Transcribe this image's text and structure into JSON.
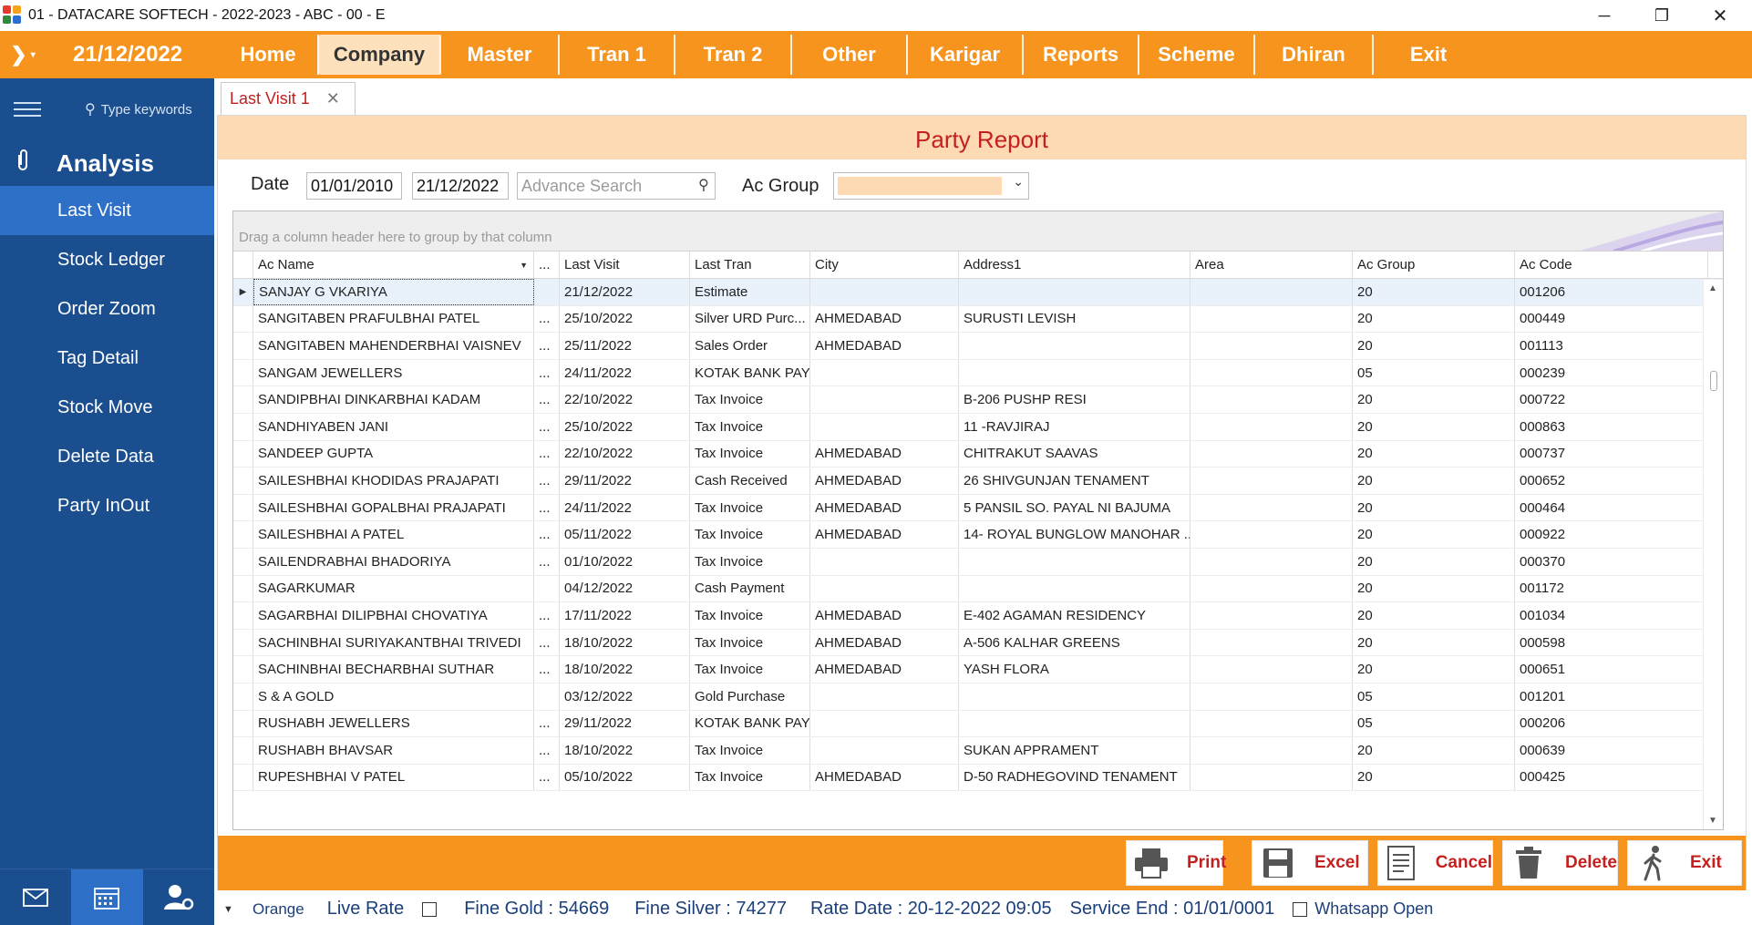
{
  "window": {
    "title": "01 - DATACARE SOFTECH - 2022-2023 - ABC - 00 - E",
    "minimize": "─",
    "maximize": "❐",
    "close": "✕"
  },
  "menubar": {
    "date": "21/12/2022",
    "items": [
      "Home",
      "Company",
      "Master",
      "Tran 1",
      "Tran 2",
      "Other",
      "Karigar",
      "Reports",
      "Scheme",
      "Dhiran",
      "Exit"
    ],
    "active": "Company"
  },
  "sidebar": {
    "search_placeholder": "Type keywords",
    "section": "Analysis",
    "items": [
      "Last Visit",
      "Stock Ledger",
      "Order Zoom",
      "Tag Detail",
      "Stock Move",
      "Delete Data",
      "Party InOut"
    ],
    "active": "Last Visit"
  },
  "tab": {
    "label": "Last Visit 1",
    "close": "✕"
  },
  "report": {
    "title": "Party Report",
    "date_label": "Date",
    "from_date": "01/01/2010",
    "to_date": "21/12/2022",
    "search_placeholder": "Advance Search",
    "acgroup_label": "Ac Group",
    "acgroup_value": ""
  },
  "grid": {
    "group_hint": "Drag a column header here to group by that column",
    "columns": [
      "Ac Name",
      "...",
      "Last Visit",
      "Last Tran",
      "City",
      "Address1",
      "Area",
      "Ac Group",
      "Ac Code"
    ],
    "rows": [
      [
        "SANJAY G VKARIYA",
        "",
        "21/12/2022",
        "Estimate",
        "",
        "",
        "",
        "20",
        "001206"
      ],
      [
        "SANGITABEN PRAFULBHAI PATEL",
        "...",
        "25/10/2022",
        "Silver URD Purc...",
        "AHMEDABAD",
        "SURUSTI LEVISH",
        "",
        "20",
        "000449"
      ],
      [
        "SANGITABEN MAHENDERBHAI VAISNEV",
        "...",
        "25/11/2022",
        "Sales Order",
        "AHMEDABAD",
        "",
        "",
        "20",
        "001113"
      ],
      [
        "SANGAM JEWELLERS",
        "...",
        "24/11/2022",
        "KOTAK BANK PAY",
        "",
        "",
        "",
        "05",
        "000239"
      ],
      [
        "SANDIPBHAI DINKARBHAI KADAM",
        "...",
        "22/10/2022",
        "Tax Invoice",
        "",
        "B-206 PUSHP RESI",
        "",
        "20",
        "000722"
      ],
      [
        "SANDHIYABEN JANI",
        "...",
        "25/10/2022",
        "Tax Invoice",
        "",
        "11 -RAVJIRAJ",
        "",
        "20",
        "000863"
      ],
      [
        "SANDEEP GUPTA",
        "...",
        "22/10/2022",
        "Tax Invoice",
        "AHMEDABAD",
        "CHITRAKUT SAAVAS",
        "",
        "20",
        "000737"
      ],
      [
        "SAILESHBHAI KHODIDAS PRAJAPATI",
        "...",
        "29/11/2022",
        "Cash Received",
        "AHMEDABAD",
        "26 SHIVGUNJAN TENAMENT",
        "",
        "20",
        "000652"
      ],
      [
        "SAILESHBHAI GOPALBHAI PRAJAPATI",
        "...",
        "24/11/2022",
        "Tax Invoice",
        "AHMEDABAD",
        "5 PANSIL SO. PAYAL NI BAJUMA",
        "",
        "20",
        "000464"
      ],
      [
        "SAILESHBHAI A PATEL",
        "...",
        "05/11/2022",
        "Tax Invoice",
        "AHMEDABAD",
        "14- ROYAL BUNGLOW MANOHAR ...",
        "",
        "20",
        "000922"
      ],
      [
        "SAILENDRABHAI BHADORIYA",
        "...",
        "01/10/2022",
        "Tax Invoice",
        "",
        "",
        "",
        "20",
        "000370"
      ],
      [
        "SAGARKUMAR",
        "",
        "04/12/2022",
        "Cash Payment",
        "",
        "",
        "",
        "20",
        "001172"
      ],
      [
        "SAGARBHAI DILIPBHAI CHOVATIYA",
        "...",
        "17/11/2022",
        "Tax Invoice",
        "AHMEDABAD",
        "E-402 AGAMAN RESIDENCY",
        "",
        "20",
        "001034"
      ],
      [
        "SACHINBHAI SURIYAKANTBHAI TRIVEDI",
        "...",
        "18/10/2022",
        "Tax Invoice",
        "AHMEDABAD",
        "A-506 KALHAR GREENS",
        "",
        "20",
        "000598"
      ],
      [
        "SACHINBHAI BECHARBHAI SUTHAR",
        "...",
        "18/10/2022",
        "Tax Invoice",
        "AHMEDABAD",
        "YASH FLORA",
        "",
        "20",
        "000651"
      ],
      [
        "S & A GOLD",
        "",
        "03/12/2022",
        "Gold Purchase",
        "",
        "",
        "",
        "05",
        "001201"
      ],
      [
        "RUSHABH JEWELLERS",
        "...",
        "29/11/2022",
        "KOTAK BANK PAY",
        "",
        "",
        "",
        "05",
        "000206"
      ],
      [
        "RUSHABH BHAVSAR",
        "...",
        "18/10/2022",
        "Tax Invoice",
        "",
        "SUKAN APPRAMENT",
        "",
        "20",
        "000639"
      ],
      [
        "RUPESHBHAI V PATEL",
        "...",
        "05/10/2022",
        "Tax Invoice",
        "AHMEDABAD",
        "D-50 RADHEGOVIND TENAMENT",
        "",
        "20",
        "000425"
      ]
    ]
  },
  "actions": [
    "Print",
    "Excel",
    "Cancel",
    "Delete",
    "Exit"
  ],
  "status": {
    "theme": "Orange",
    "live_rate": "Live Rate",
    "fine_gold": "Fine Gold : 54669",
    "fine_silver": "Fine Silver : 74277",
    "rate_date": "Rate Date : 20-12-2022 09:05",
    "service_end": "Service End :  01/01/0001",
    "whatsapp": "Whatsapp Open"
  },
  "colors": {
    "accent": "#f7941d",
    "sidebar": "#1b4e8f",
    "sidebar_active": "#2e70c7",
    "title_red": "#c42020"
  }
}
